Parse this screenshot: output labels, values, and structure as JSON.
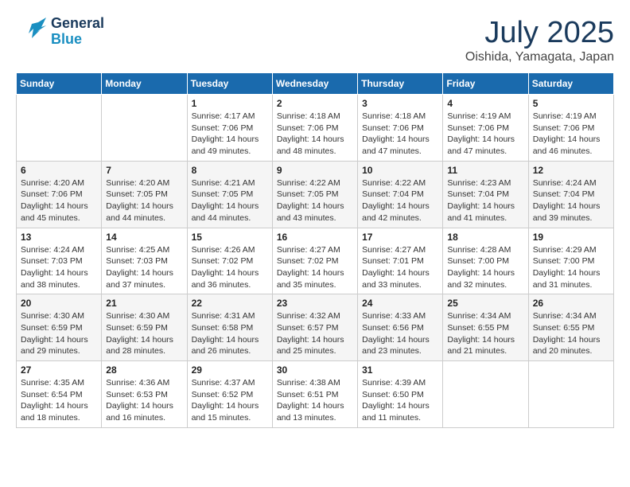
{
  "header": {
    "logo_general": "General",
    "logo_blue": "Blue",
    "month_year": "July 2025",
    "location": "Oishida, Yamagata, Japan"
  },
  "days_of_week": [
    "Sunday",
    "Monday",
    "Tuesday",
    "Wednesday",
    "Thursday",
    "Friday",
    "Saturday"
  ],
  "weeks": [
    [
      {
        "day": "",
        "detail": ""
      },
      {
        "day": "",
        "detail": ""
      },
      {
        "day": "1",
        "detail": "Sunrise: 4:17 AM\nSunset: 7:06 PM\nDaylight: 14 hours\nand 49 minutes."
      },
      {
        "day": "2",
        "detail": "Sunrise: 4:18 AM\nSunset: 7:06 PM\nDaylight: 14 hours\nand 48 minutes."
      },
      {
        "day": "3",
        "detail": "Sunrise: 4:18 AM\nSunset: 7:06 PM\nDaylight: 14 hours\nand 47 minutes."
      },
      {
        "day": "4",
        "detail": "Sunrise: 4:19 AM\nSunset: 7:06 PM\nDaylight: 14 hours\nand 47 minutes."
      },
      {
        "day": "5",
        "detail": "Sunrise: 4:19 AM\nSunset: 7:06 PM\nDaylight: 14 hours\nand 46 minutes."
      }
    ],
    [
      {
        "day": "6",
        "detail": "Sunrise: 4:20 AM\nSunset: 7:06 PM\nDaylight: 14 hours\nand 45 minutes."
      },
      {
        "day": "7",
        "detail": "Sunrise: 4:20 AM\nSunset: 7:05 PM\nDaylight: 14 hours\nand 44 minutes."
      },
      {
        "day": "8",
        "detail": "Sunrise: 4:21 AM\nSunset: 7:05 PM\nDaylight: 14 hours\nand 44 minutes."
      },
      {
        "day": "9",
        "detail": "Sunrise: 4:22 AM\nSunset: 7:05 PM\nDaylight: 14 hours\nand 43 minutes."
      },
      {
        "day": "10",
        "detail": "Sunrise: 4:22 AM\nSunset: 7:04 PM\nDaylight: 14 hours\nand 42 minutes."
      },
      {
        "day": "11",
        "detail": "Sunrise: 4:23 AM\nSunset: 7:04 PM\nDaylight: 14 hours\nand 41 minutes."
      },
      {
        "day": "12",
        "detail": "Sunrise: 4:24 AM\nSunset: 7:04 PM\nDaylight: 14 hours\nand 39 minutes."
      }
    ],
    [
      {
        "day": "13",
        "detail": "Sunrise: 4:24 AM\nSunset: 7:03 PM\nDaylight: 14 hours\nand 38 minutes."
      },
      {
        "day": "14",
        "detail": "Sunrise: 4:25 AM\nSunset: 7:03 PM\nDaylight: 14 hours\nand 37 minutes."
      },
      {
        "day": "15",
        "detail": "Sunrise: 4:26 AM\nSunset: 7:02 PM\nDaylight: 14 hours\nand 36 minutes."
      },
      {
        "day": "16",
        "detail": "Sunrise: 4:27 AM\nSunset: 7:02 PM\nDaylight: 14 hours\nand 35 minutes."
      },
      {
        "day": "17",
        "detail": "Sunrise: 4:27 AM\nSunset: 7:01 PM\nDaylight: 14 hours\nand 33 minutes."
      },
      {
        "day": "18",
        "detail": "Sunrise: 4:28 AM\nSunset: 7:00 PM\nDaylight: 14 hours\nand 32 minutes."
      },
      {
        "day": "19",
        "detail": "Sunrise: 4:29 AM\nSunset: 7:00 PM\nDaylight: 14 hours\nand 31 minutes."
      }
    ],
    [
      {
        "day": "20",
        "detail": "Sunrise: 4:30 AM\nSunset: 6:59 PM\nDaylight: 14 hours\nand 29 minutes."
      },
      {
        "day": "21",
        "detail": "Sunrise: 4:30 AM\nSunset: 6:59 PM\nDaylight: 14 hours\nand 28 minutes."
      },
      {
        "day": "22",
        "detail": "Sunrise: 4:31 AM\nSunset: 6:58 PM\nDaylight: 14 hours\nand 26 minutes."
      },
      {
        "day": "23",
        "detail": "Sunrise: 4:32 AM\nSunset: 6:57 PM\nDaylight: 14 hours\nand 25 minutes."
      },
      {
        "day": "24",
        "detail": "Sunrise: 4:33 AM\nSunset: 6:56 PM\nDaylight: 14 hours\nand 23 minutes."
      },
      {
        "day": "25",
        "detail": "Sunrise: 4:34 AM\nSunset: 6:55 PM\nDaylight: 14 hours\nand 21 minutes."
      },
      {
        "day": "26",
        "detail": "Sunrise: 4:34 AM\nSunset: 6:55 PM\nDaylight: 14 hours\nand 20 minutes."
      }
    ],
    [
      {
        "day": "27",
        "detail": "Sunrise: 4:35 AM\nSunset: 6:54 PM\nDaylight: 14 hours\nand 18 minutes."
      },
      {
        "day": "28",
        "detail": "Sunrise: 4:36 AM\nSunset: 6:53 PM\nDaylight: 14 hours\nand 16 minutes."
      },
      {
        "day": "29",
        "detail": "Sunrise: 4:37 AM\nSunset: 6:52 PM\nDaylight: 14 hours\nand 15 minutes."
      },
      {
        "day": "30",
        "detail": "Sunrise: 4:38 AM\nSunset: 6:51 PM\nDaylight: 14 hours\nand 13 minutes."
      },
      {
        "day": "31",
        "detail": "Sunrise: 4:39 AM\nSunset: 6:50 PM\nDaylight: 14 hours\nand 11 minutes."
      },
      {
        "day": "",
        "detail": ""
      },
      {
        "day": "",
        "detail": ""
      }
    ]
  ]
}
